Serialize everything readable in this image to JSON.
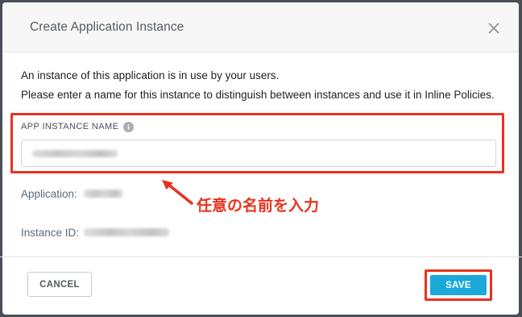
{
  "dialog": {
    "title": "Create Application Instance",
    "close_icon": "close-icon",
    "intro_line_1": "An instance of this application is in use by your users.",
    "intro_line_2": "Please enter a name for this instance to distinguish between instances and use it in Inline Policies."
  },
  "field": {
    "label": "APP INSTANCE NAME",
    "info_icon": "info-icon"
  },
  "details": {
    "application_label": "Application:",
    "instance_id_label": "Instance ID:"
  },
  "annotation": {
    "text": "任意の名前を入力",
    "color": "#e8321f"
  },
  "footer": {
    "cancel_label": "CANCEL",
    "save_label": "SAVE",
    "save_color": "#1aa9d9"
  }
}
